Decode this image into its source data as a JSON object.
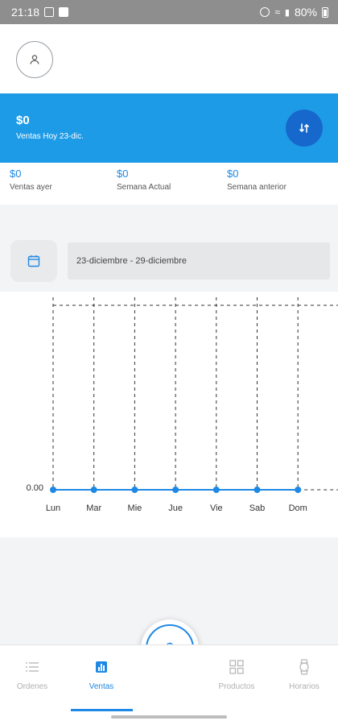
{
  "status_bar": {
    "time": "21:18",
    "battery": "80%"
  },
  "banner": {
    "amount": "$0",
    "label": "Ventas Hoy 23-dic."
  },
  "stats": [
    {
      "value": "$0",
      "label": "Ventas ayer"
    },
    {
      "value": "$0",
      "label": "Semana Actual"
    },
    {
      "value": "$0",
      "label": "Semana anterior"
    }
  ],
  "date_range": "23-diciembre - 29-diciembre",
  "chart_data": {
    "type": "line",
    "categories": [
      "Lun",
      "Mar",
      "Mie",
      "Jue",
      "Vie",
      "Sab",
      "Dom"
    ],
    "values": [
      0,
      0,
      0,
      0,
      0,
      0,
      0
    ],
    "y_tick_labels": [
      "0.00"
    ],
    "ylim": [
      0,
      1
    ],
    "grid": true,
    "color": "#1e88e5"
  },
  "fab": {
    "label": "$"
  },
  "nav": [
    {
      "label": "Ordenes",
      "icon": "list-icon"
    },
    {
      "label": "Ventas",
      "icon": "bar-chart-icon"
    },
    {
      "label": "Productos",
      "icon": "grid-icon"
    },
    {
      "label": "Horarios",
      "icon": "watch-icon"
    }
  ],
  "colors": {
    "accent": "#1e88e5",
    "banner": "#1e9be6",
    "banner_button": "#1668cc"
  }
}
